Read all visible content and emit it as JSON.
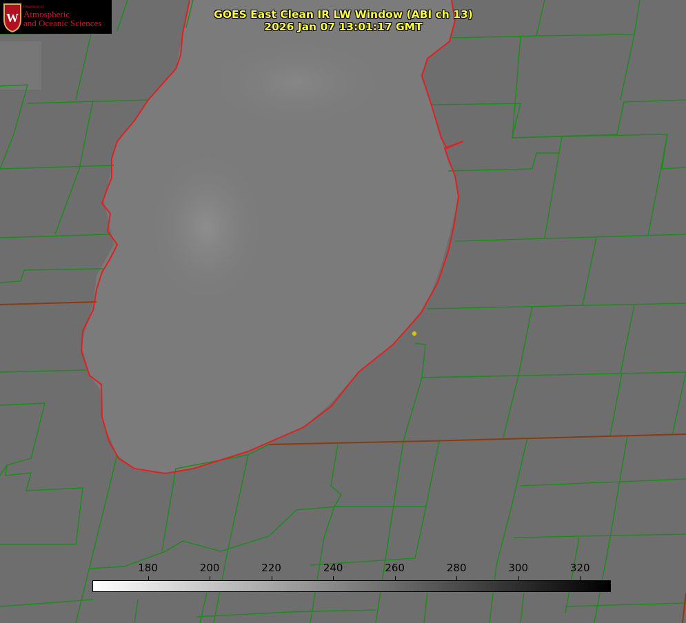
{
  "title": {
    "line1": "GOES East Clean IR LW Window (ABI ch 13)",
    "line2": "2026 Jan 07 13:01:17 GMT"
  },
  "logo": {
    "small": "Department of",
    "line1": "Atmospheric",
    "line2": "and Oceanic Sciences",
    "emblem_letter": "W"
  },
  "colorbar": {
    "min": 162,
    "max": 330,
    "ticks": [
      "180",
      "200",
      "220",
      "240",
      "260",
      "280",
      "300",
      "320"
    ],
    "tick_values": [
      180,
      200,
      220,
      240,
      260,
      280,
      300,
      320
    ]
  },
  "colors": {
    "county_lines": "#1a8c1a",
    "shoreline": "#e02020",
    "marker": "#d4c020",
    "title": "#ffff3c"
  }
}
